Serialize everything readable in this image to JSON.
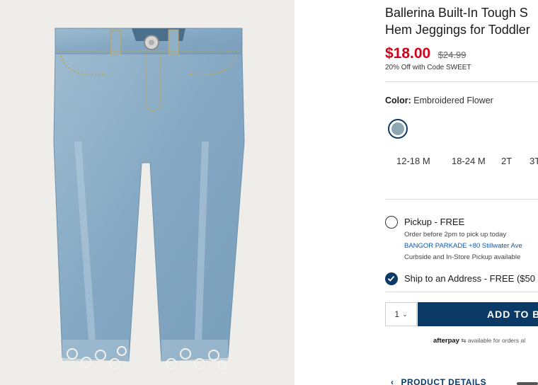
{
  "product": {
    "title": "Ballerina Built-In Tough S\nHem Jeggings for Toddler",
    "sale_price": "$18.00",
    "original_price": "$24.99",
    "promo": "20% Off with Code SWEET",
    "image_icon": "jeans-photo"
  },
  "color": {
    "label": "Color:",
    "value": "Embroidered Flower",
    "swatch_color": "#8fa6b3",
    "selected_ring_color": "#0b3a66"
  },
  "sizes": [
    "12-18 M",
    "18-24 M",
    "2T",
    "3T"
  ],
  "fulfillment": {
    "pickup": {
      "label": "Pickup - FREE",
      "line1": "Order before 2pm to pick up today",
      "store": "BANGOR PARKADE +80 Stillwater Ave",
      "line3": "Curbside and In-Store Pickup available",
      "selected": false
    },
    "ship": {
      "label": "Ship to an Address - FREE ($50",
      "selected": true
    }
  },
  "cart": {
    "quantity": "1",
    "add_label": "ADD TO BAG"
  },
  "afterpay": {
    "brand": "afterpay",
    "text": "available for orders al"
  },
  "details_section": {
    "label": "PRODUCT DETAILS"
  },
  "colors": {
    "sale": "#d0021b",
    "brand_navy": "#0b3a66"
  }
}
